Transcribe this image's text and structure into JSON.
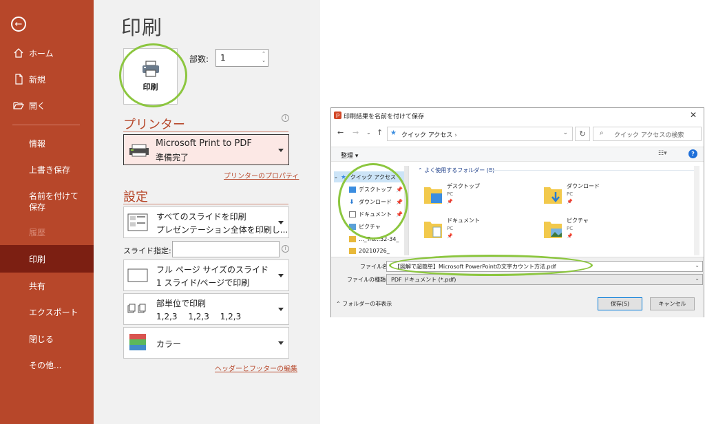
{
  "nav": {
    "items": [
      {
        "label": "ホーム"
      },
      {
        "label": "新規"
      },
      {
        "label": "開く"
      },
      {
        "label": "情報"
      },
      {
        "label": "上書き保存"
      },
      {
        "label": "名前を付けて保存"
      },
      {
        "label": "履歴"
      },
      {
        "label": "印刷"
      },
      {
        "label": "共有"
      },
      {
        "label": "エクスポート"
      },
      {
        "label": "閉じる"
      },
      {
        "label": "その他..."
      }
    ]
  },
  "print": {
    "title": "印刷",
    "print_button": "印刷",
    "copies_label": "部数:",
    "copies_value": "1",
    "printer_heading": "プリンター",
    "printer_name": "Microsoft Print to PDF",
    "printer_status": "準備完了",
    "printer_props_link": "プリンターのプロパティ",
    "settings_heading": "設定",
    "slides_option": {
      "line1": "すべてのスライドを印刷",
      "line2": "プレゼンテーション全体を印刷し..."
    },
    "slide_spec_label": "スライド指定:",
    "layout_option": {
      "line1": "フル ページ サイズのスライド",
      "line2": "1 スライド/ページで印刷"
    },
    "collate_option": {
      "line1": "部単位で印刷",
      "line2": "1,2,3　 1,2,3　 1,2,3"
    },
    "color_option": {
      "line1": "カラー"
    },
    "header_footer_link": "ヘッダーとフッターの編集"
  },
  "dialog": {
    "title": "印刷結果を名前を付けて保存",
    "address": "クイック アクセス",
    "search_placeholder": "クイック アクセスの検索",
    "organize": "整理 ▾",
    "tree": [
      {
        "label": "クイック アクセス"
      },
      {
        "label": "デスクトップ"
      },
      {
        "label": "ダウンロード"
      },
      {
        "label": "ドキュメント"
      },
      {
        "label": "ピクチャ"
      },
      {
        "label": "..._Tra...32-34_"
      },
      {
        "label": "20210726_"
      }
    ],
    "frequent_header": "よく使用するフォルダー (8)",
    "folders": [
      {
        "name": "デスクトップ",
        "sub": "PC"
      },
      {
        "name": "ダウンロード",
        "sub": "PC"
      },
      {
        "name": "ドキュメント",
        "sub": "PC"
      },
      {
        "name": "ピクチャ",
        "sub": "PC"
      }
    ],
    "filename_label": "ファイル名(N):",
    "filename_value": "【図解で超簡単】Microsoft PowerPointの文字カウント方法.pdf",
    "filetype_label": "ファイルの種類(T):",
    "filetype_value": "PDF ドキュメント (*.pdf)",
    "hide_folders": "フォルダーの非表示",
    "save_button": "保存(S)",
    "cancel_button": "キャンセル"
  },
  "colors": {
    "accent": "#b7472a",
    "highlight": "#8cc63f",
    "active_nav": "#7c1f12"
  }
}
